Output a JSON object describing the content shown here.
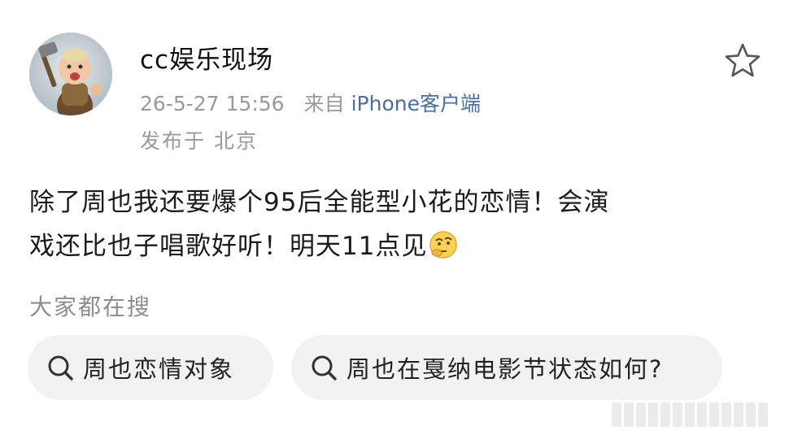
{
  "post": {
    "author": "cc娱乐现场",
    "timestamp": "26-5-27 15:56",
    "source_prefix": "来自",
    "source_client": "iPhone客户端",
    "location": "发布于 北京",
    "text_line1": "除了周也我还要爆个95后全能型小花的恋情！会演",
    "text_line2": "戏还比也子唱歌好听！明天11点见",
    "emoji_icon": "thinking-face-icon",
    "favorite_icon": "star-outline-icon"
  },
  "search": {
    "title": "大家都在搜",
    "suggestions": [
      {
        "label": "周也恋情对象",
        "icon": "search-icon"
      },
      {
        "label": "周也在戛纳电影节状态如何?",
        "icon": "search-icon"
      }
    ]
  },
  "colors": {
    "link": "#4b6f9a",
    "muted": "#9a9a9a",
    "chip_bg": "#f2f2f2"
  }
}
